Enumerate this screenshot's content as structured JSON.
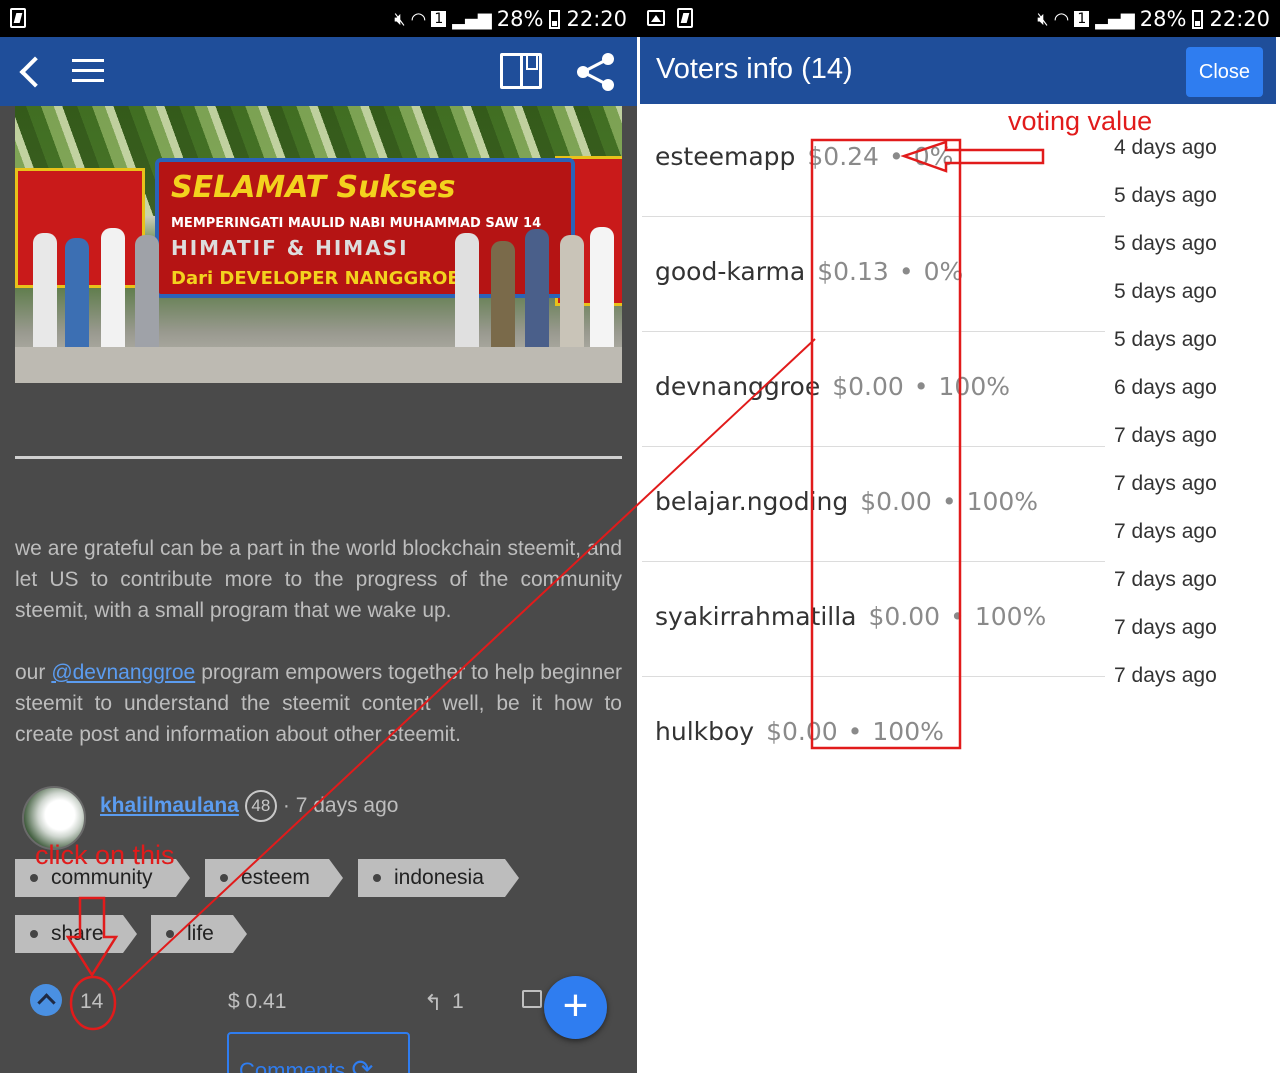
{
  "status_bar": {
    "battery": "28%",
    "time": "22:20",
    "sim_label": "1"
  },
  "left": {
    "photo_banner": {
      "line1": "SELAMAT Sukses",
      "line2": "MEMPERINGATI MAULID NABI MUHAMMAD SAW 14",
      "line3": "HIMATIF & HIMASI",
      "line4": "Dari DEVELOPER NANGGROE"
    },
    "body": {
      "paragraph1": "we are grateful can be a part in the world blockchain steemit, and let US to contribute more to the progress of the community steemit, with a small program that we wake up.",
      "paragraph2_prefix": "our",
      "paragraph2_link": "@devnanggroe",
      "paragraph2_suffix": "program empowers together to help beginner steemit to understand the steemit content well, be it how to create post and information about other steemit."
    },
    "author": {
      "name": "khalilmaulana",
      "reputation": "48",
      "time": "· 7 days ago"
    },
    "tags": [
      "community",
      "esteem",
      "indonesia",
      "share",
      "life"
    ],
    "actions": {
      "vote_count": "14",
      "payout": "$ 0.41",
      "replies": "1",
      "fab_label": "+",
      "comments_label": "Comments"
    },
    "icons": {
      "back": "back-arrow-icon",
      "menu": "hamburger-menu-icon",
      "book": "book-icon",
      "share": "share-icon",
      "vote": "upvote-icon",
      "reply": "reply-icon",
      "edit": "edit-icon",
      "refresh": "refresh-icon"
    }
  },
  "right": {
    "title": "Voters info (14)",
    "close_label": "Close",
    "voters": [
      {
        "name": "esteemapp",
        "amount": "$0.24",
        "percent": "0%"
      },
      {
        "name": "good-karma",
        "amount": "$0.13",
        "percent": "0%"
      },
      {
        "name": "devnanggroe",
        "amount": "$0.00",
        "percent": "100%"
      },
      {
        "name": "belajar.ngoding",
        "amount": "$0.00",
        "percent": "100%"
      },
      {
        "name": "syakirrahmatilla",
        "amount": "$0.00",
        "percent": "100%"
      },
      {
        "name": "hulkboy",
        "amount": "$0.00",
        "percent": "100%"
      }
    ],
    "times": [
      "4 days ago",
      "5 days ago",
      "5 days ago",
      "5 days ago",
      "5 days ago",
      "6 days ago",
      "7 days ago",
      "7 days ago",
      "7 days ago",
      "7 days ago",
      "7 days ago",
      "7 days ago"
    ]
  },
  "annotations": {
    "voting_value": "voting value",
    "click_on_this": "click on this"
  },
  "colors": {
    "appbar": "#1f4e9a",
    "accent": "#2f7df0",
    "annotation": "#e11b1b",
    "left_background": "#4a4a4a"
  }
}
